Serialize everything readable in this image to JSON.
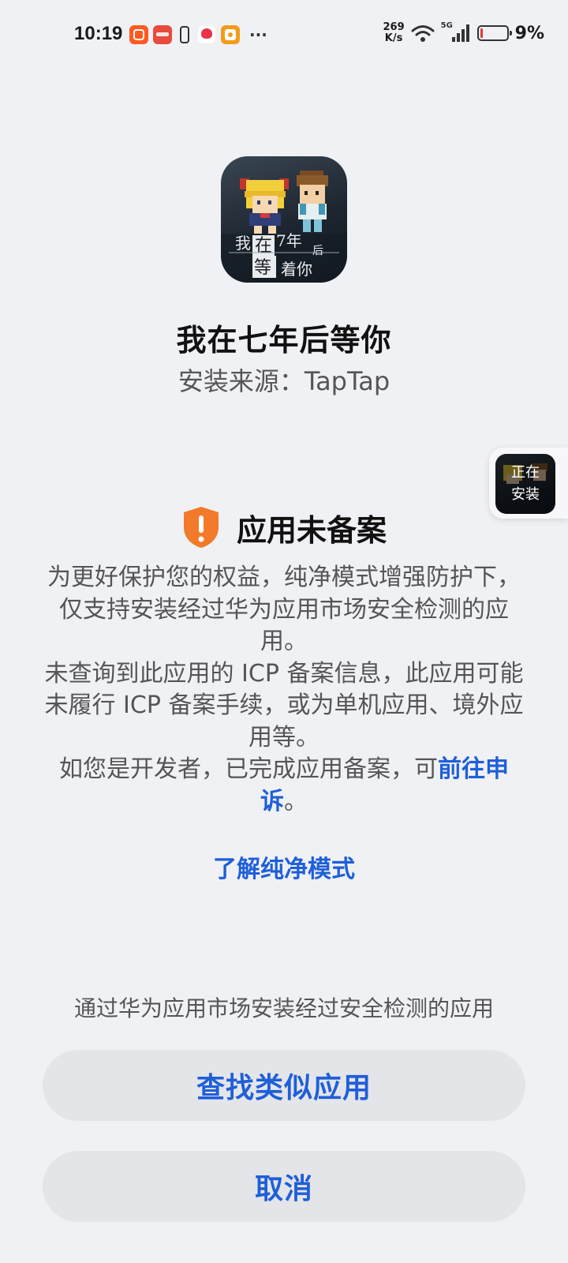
{
  "status_bar": {
    "time": "10:19",
    "net_speed_value": "269",
    "net_speed_unit": "K/s",
    "network": "5G",
    "battery_percent": "9%",
    "battery_level": 0.09,
    "more": "···"
  },
  "app": {
    "name": "我在七年后等你",
    "install_source": "安装来源：TapTap",
    "icon_text_line1": "我在7年后",
    "icon_text_line2": "等着你"
  },
  "installing": {
    "label_line1": "正在",
    "label_line2": "安装"
  },
  "warning": {
    "title": "应用未备案",
    "paragraph1": "为更好保护您的权益，纯净模式增强防护下，仅支持安装经过华为应用市场安全检测的应用。",
    "paragraph2": "未查询到此应用的 ICP 备案信息，此应用可能未履行 ICP 备案手续，或为单机应用、境外应用等。",
    "paragraph3_prefix": "如您是开发者，已完成应用备案，可",
    "paragraph3_link": "前往申诉",
    "paragraph3_suffix": "。",
    "learn_more": "了解纯净模式"
  },
  "footer": {
    "hint": "通过华为应用市场安装经过安全检测的应用",
    "find_similar": "查找类似应用",
    "cancel": "取消"
  },
  "colors": {
    "background": "#f0f1f5",
    "accent": "#1f5fd8",
    "warning": "#f27a2a",
    "button_bg": "#e4e5e9"
  }
}
